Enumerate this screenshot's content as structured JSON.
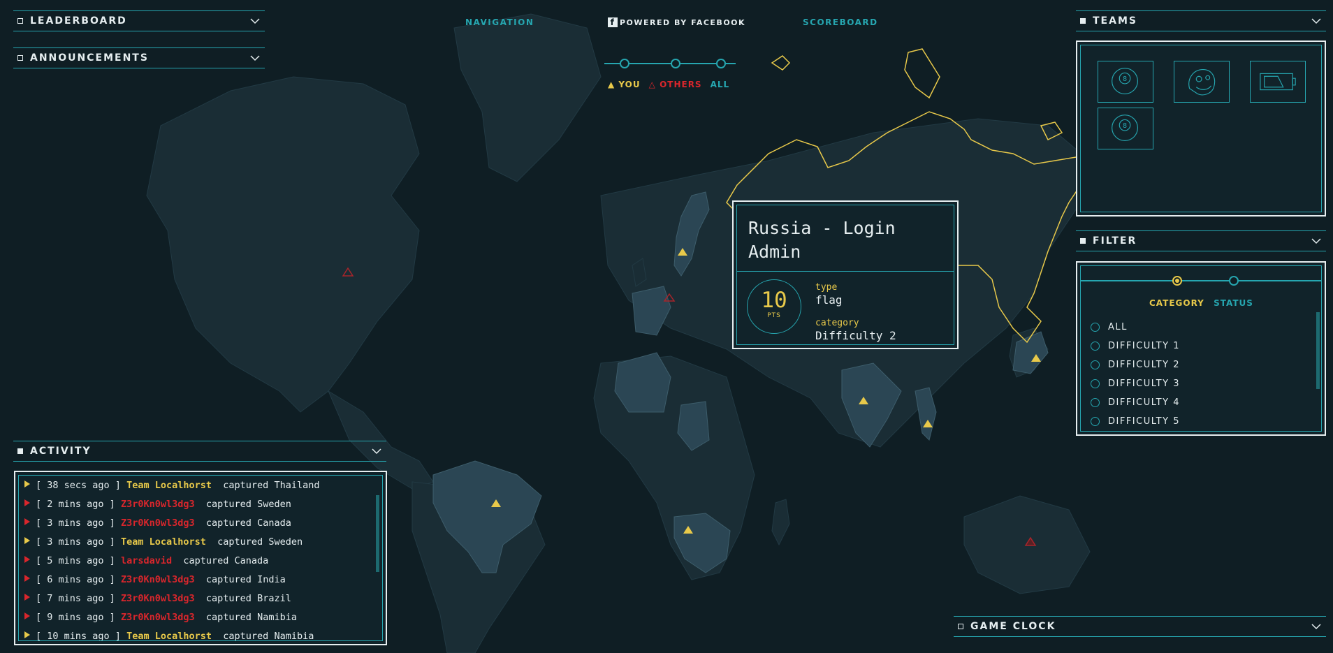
{
  "header": {
    "navigation": "NAVIGATION",
    "powered_by": "POWERED BY FACEBOOK",
    "scoreboard": "SCOREBOARD"
  },
  "view_toggle": {
    "you": "YOU",
    "others": "OTHERS",
    "all": "ALL"
  },
  "panels": {
    "leaderboard": "LEADERBOARD",
    "announcements": "ANNOUNCEMENTS",
    "teams": "TEAMS",
    "filter": "FILTER",
    "activity": "ACTIVITY",
    "game_clock": "GAME CLOCK"
  },
  "teams": {
    "tiles": [
      {
        "icon": "eight-ball-icon"
      },
      {
        "icon": "troll-face-icon"
      },
      {
        "icon": "battery-icon"
      },
      {
        "icon": "eight-ball-icon"
      }
    ]
  },
  "filter": {
    "tabs": [
      "CATEGORY",
      "STATUS"
    ],
    "active_tab": "CATEGORY",
    "options": [
      "ALL",
      "DIFFICULTY 1",
      "DIFFICULTY 2",
      "DIFFICULTY 3",
      "DIFFICULTY 4",
      "DIFFICULTY 5"
    ]
  },
  "popup": {
    "title": "Russia - Login Admin",
    "points": "10",
    "points_unit": "PTS",
    "type_label": "type",
    "type_value": "flag",
    "category_label": "category",
    "category_value": "Difficulty 2"
  },
  "activity": [
    {
      "time": "38 secs ago",
      "team": "Team Localhorst",
      "own": true,
      "action": "captured",
      "country": "Thailand"
    },
    {
      "time": "2 mins ago",
      "team": "Z3r0Kn0wl3dg3",
      "own": false,
      "action": "captured",
      "country": "Sweden"
    },
    {
      "time": "3 mins ago",
      "team": "Z3r0Kn0wl3dg3",
      "own": false,
      "action": "captured",
      "country": "Canada"
    },
    {
      "time": "3 mins ago",
      "team": "Team Localhorst",
      "own": true,
      "action": "captured",
      "country": "Sweden"
    },
    {
      "time": "5 mins ago",
      "team": "larsdavid",
      "own": false,
      "action": "captured",
      "country": "Canada"
    },
    {
      "time": "6 mins ago",
      "team": "Z3r0Kn0wl3dg3",
      "own": false,
      "action": "captured",
      "country": "India"
    },
    {
      "time": "7 mins ago",
      "team": "Z3r0Kn0wl3dg3",
      "own": false,
      "action": "captured",
      "country": "Brazil"
    },
    {
      "time": "9 mins ago",
      "team": "Z3r0Kn0wl3dg3",
      "own": false,
      "action": "captured",
      "country": "Namibia"
    },
    {
      "time": "10 mins ago",
      "team": "Team Localhorst",
      "own": true,
      "action": "captured",
      "country": "Namibia"
    }
  ],
  "colors": {
    "background": "#0f1e24",
    "accent": "#26a6b0",
    "own_team": "#e8c94a",
    "other_team": "#d9262c"
  }
}
